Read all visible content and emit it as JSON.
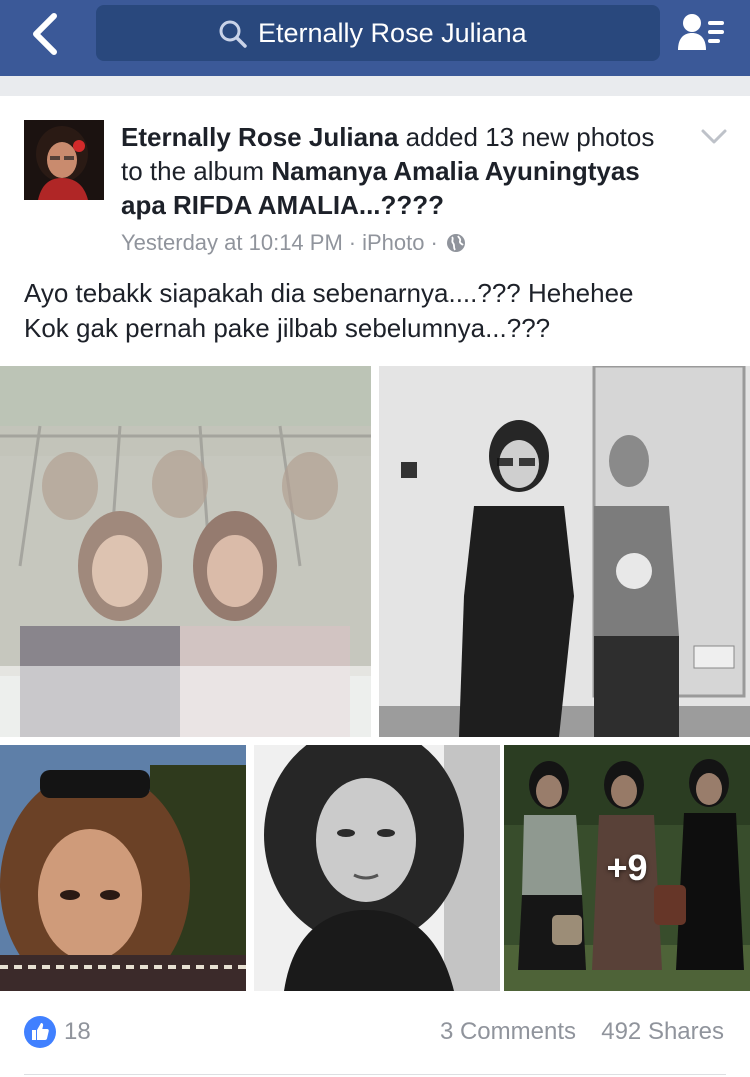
{
  "topbar": {
    "search_text": "Eternally Rose Juliana",
    "back_icon": "chevron-left-icon",
    "search_icon": "search-icon",
    "friends_icon": "friend-requests-icon",
    "color": "#3b5998"
  },
  "post": {
    "author": "Eternally Rose Juliana",
    "action": " added 13 new photos to the album ",
    "album": "Namanya Amalia Ayuningtyas apa RIFDA AMALIA...????",
    "time": "Yesterday at 10:14 PM",
    "app": "iPhoto",
    "privacy_icon": "globe-icon",
    "caption_lines": [
      "Ayo tebakk siapakah dia sebenarnya....??? Hehehee",
      "Kok gak pernah pake jilbab sebelumnya...???"
    ],
    "more_photos": "+9",
    "likes": "18",
    "comments": "3 Comments",
    "shares": "492 Shares"
  }
}
